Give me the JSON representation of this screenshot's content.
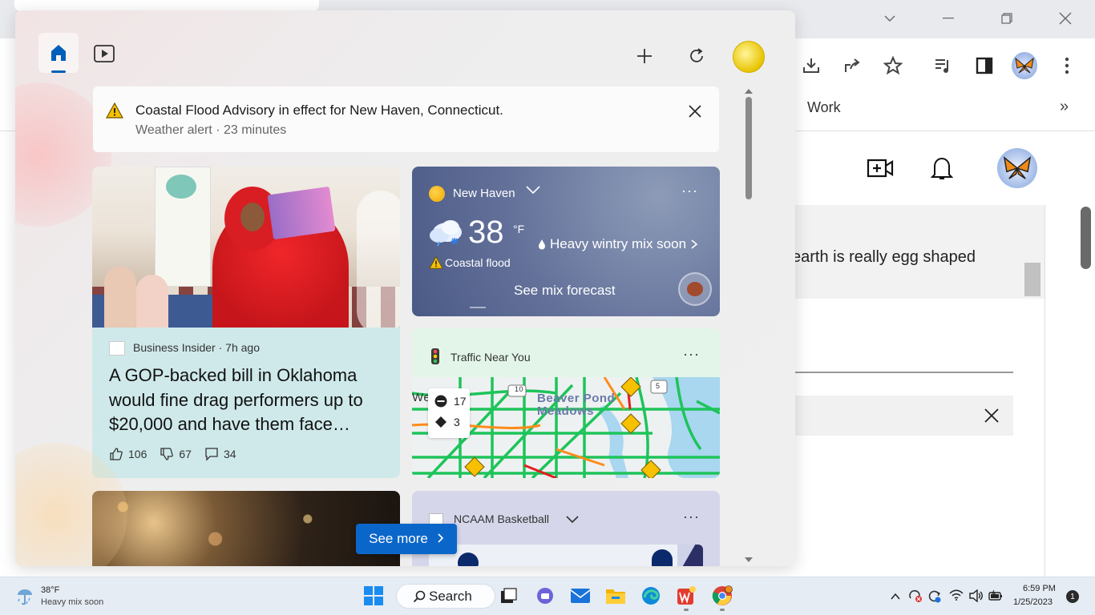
{
  "browser": {
    "bookmark_work": "Work",
    "bookmark_more": "»",
    "search_result_text": "earth is really egg shaped"
  },
  "widgets": {
    "alert": {
      "title": "Coastal Flood Advisory in effect for New Haven, Connecticut.",
      "subtitle": "Weather alert · 23 minutes"
    },
    "news": {
      "source": "Business Insider · 7h ago",
      "title": "A GOP-backed bill in Oklahoma would fine drag performers up to $20,000 and have them face…",
      "likes": "106",
      "dislikes": "67",
      "comments": "34"
    },
    "weather": {
      "location": "New Haven",
      "temperature": "38",
      "unit": "°F",
      "condition": "Heavy wintry mix soon",
      "warning": "Coastal flood",
      "forecast_link": "See mix forecast"
    },
    "traffic": {
      "title": "Traffic Near You",
      "closures": "17",
      "constructions": "3",
      "map_labels": [
        "Beaver Pond",
        "Meadows",
        "10",
        "5",
        "We"
      ]
    },
    "ncaa": {
      "title": "NCAAM Basketball"
    },
    "see_more": "See more"
  },
  "taskbar": {
    "temperature": "38°F",
    "condition": "Heavy mix soon",
    "search_label": "Search",
    "time": "6:59 PM",
    "date": "1/25/2023",
    "notification_count": "1"
  },
  "colors": {
    "accent": "#005fb8",
    "see_more_bg": "#0b66c9",
    "weather_card": "#5d6b95",
    "traffic_card": "#e3f5e8"
  }
}
